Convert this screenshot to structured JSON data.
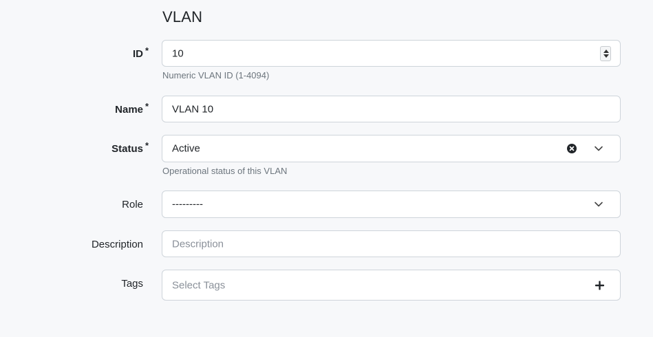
{
  "section": {
    "title": "VLAN"
  },
  "required_marker": "*",
  "fields": {
    "id": {
      "label": "ID",
      "value": "10",
      "help": "Numeric VLAN ID (1-4094)"
    },
    "name": {
      "label": "Name",
      "value": "VLAN 10"
    },
    "status": {
      "label": "Status",
      "value": "Active",
      "help": "Operational status of this VLAN"
    },
    "role": {
      "label": "Role",
      "value": "---------"
    },
    "description": {
      "label": "Description",
      "placeholder": "Description"
    },
    "tags": {
      "label": "Tags",
      "placeholder": "Select Tags"
    }
  },
  "icons": {
    "stepper": "number-stepper-icon",
    "clear": "clear-circle-icon",
    "chevron": "chevron-down-icon",
    "plus": "plus-icon"
  },
  "colors": {
    "background": "#f7f8fa",
    "field_border": "#ced4da",
    "help_text": "#6c757d",
    "placeholder": "#8a9099"
  }
}
